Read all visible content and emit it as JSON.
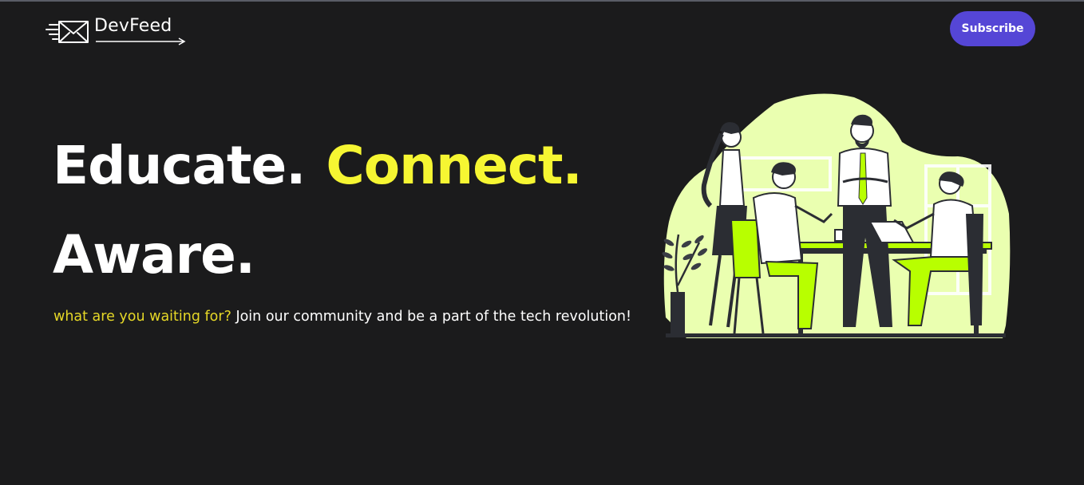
{
  "header": {
    "brand": "DevFeed",
    "subscribe_label": "Subscribe"
  },
  "hero": {
    "word1": "Educate.",
    "word2": "Connect.",
    "word3": "Aware.",
    "tagline_accent": "what are you waiting for?",
    "tagline_rest": " Join our community and be a part of the tech revolution!"
  },
  "colors": {
    "background": "#1b1b1c",
    "accent_yellow": "#f6f632",
    "button": "#5546d6",
    "illustration_lime": "#b8ff00",
    "illustration_bg": "#eaffb0"
  },
  "icons": {
    "logo": "envelope-speed-icon",
    "illustration": "team-meeting-illustration"
  }
}
